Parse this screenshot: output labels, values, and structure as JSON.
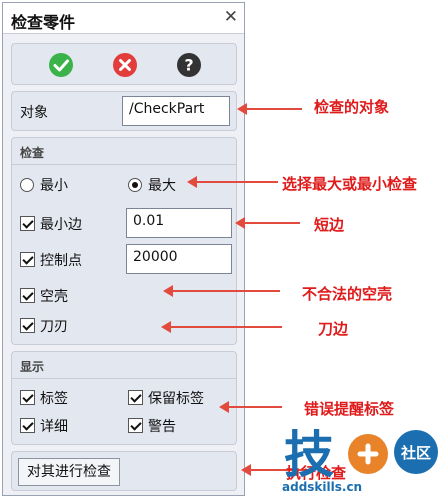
{
  "window": {
    "title": "检查零件"
  },
  "toolbar": {
    "ok_icon": "check-circle-green",
    "cancel_icon": "x-circle-red",
    "help_icon": "question-circle-dark"
  },
  "object": {
    "label": "对象",
    "value": "/CheckPart"
  },
  "check": {
    "title": "检查",
    "radio_min": "最小",
    "radio_max": "最大",
    "selected": "最大",
    "min_edge_label": "最小边",
    "min_edge_value": "0.01",
    "control_points_label": "控制点",
    "control_points_value": "20000",
    "empty_shell_label": "空壳",
    "blade_label": "刀刃"
  },
  "display": {
    "title": "显示",
    "tags_label": "标签",
    "keep_tags_label": "保留标签",
    "detail_label": "详细",
    "warning_label": "警告"
  },
  "action": {
    "run_label": "对其进行检查"
  },
  "annotations": {
    "object": "检查的对象",
    "minmax": "选择最大或最小检查",
    "short_edge": "短边",
    "invalid_shell": "不合法的空壳",
    "blade_edge": "刀边",
    "error_tags": "错误提醒标签",
    "run_check": "执行检查"
  },
  "watermark": {
    "glyph": "技",
    "cn": "社区",
    "site": "addskills.cn"
  },
  "colors": {
    "accent_arrow": "#e24a3e",
    "ok": "#3bb34a",
    "cancel": "#e23c3c",
    "help": "#333333"
  }
}
